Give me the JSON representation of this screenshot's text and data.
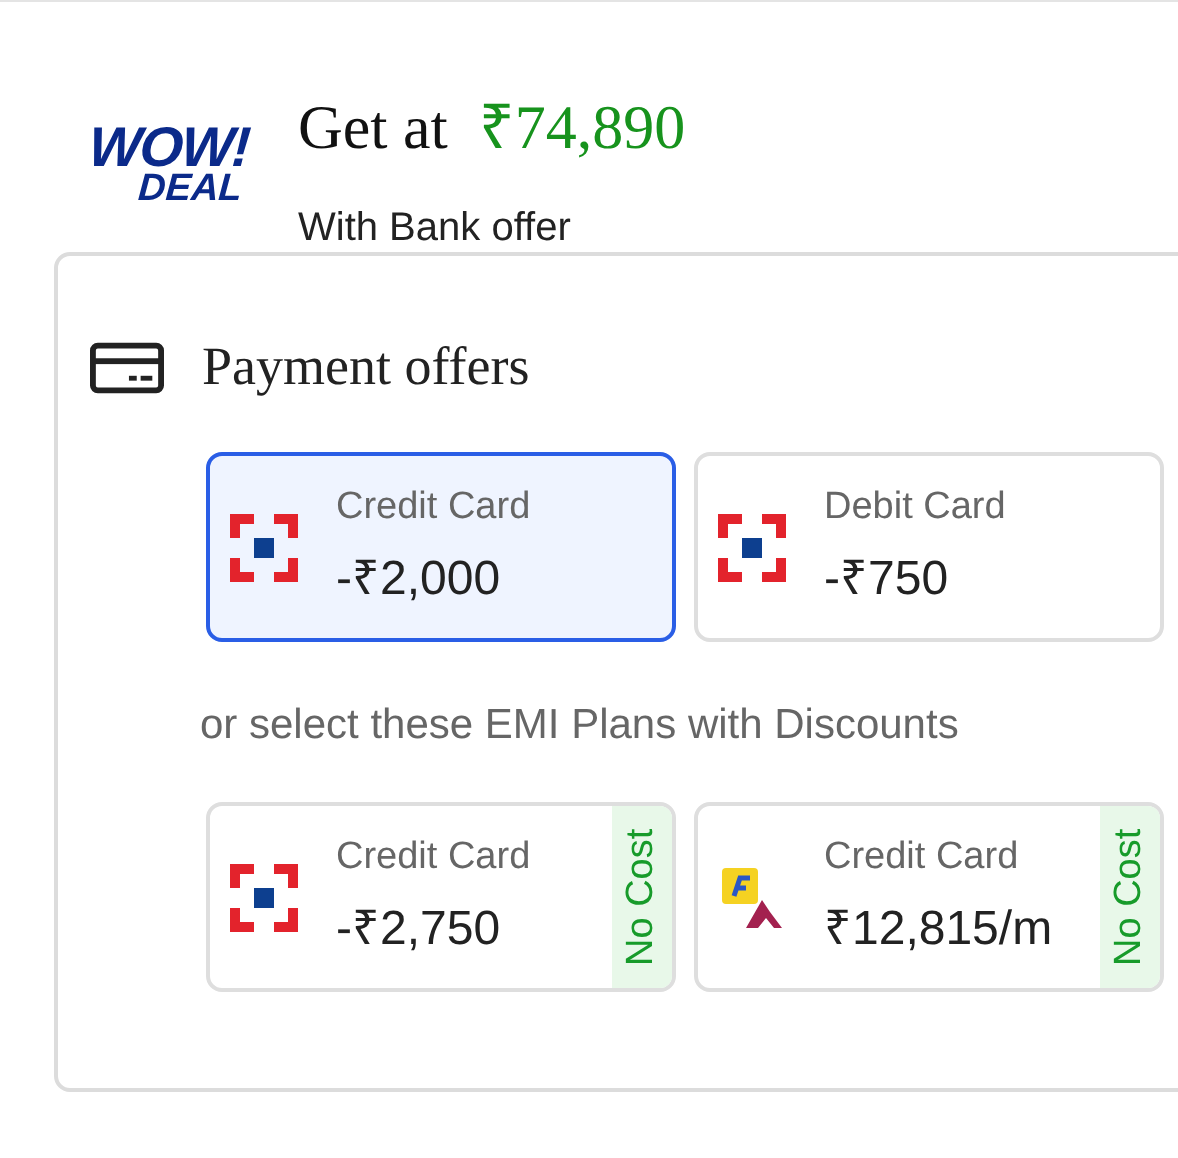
{
  "deal": {
    "logo_top": "WOW!",
    "logo_bottom": "DEAL",
    "prefix": "Get at",
    "price": "₹74,890",
    "subtitle": "With Bank offer"
  },
  "payment_offers": {
    "title": "Payment offers",
    "offers": [
      {
        "kind": "bank",
        "label": "Credit Card",
        "amount": "-₹2,000",
        "selected": true
      },
      {
        "kind": "bank",
        "label": "Debit Card",
        "amount": "-₹750",
        "selected": false
      }
    ],
    "emi_heading": "or select these EMI Plans with Discounts",
    "emi_plans": [
      {
        "kind": "bank",
        "label": "Credit Card",
        "amount": "-₹2,750",
        "badge": "No Cost",
        "selected": false
      },
      {
        "kind": "cobrand",
        "label": "Credit Card",
        "amount": "₹12,815/m",
        "badge": "No Cost",
        "selected": false
      }
    ]
  }
}
